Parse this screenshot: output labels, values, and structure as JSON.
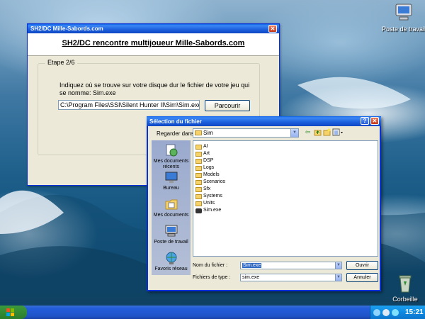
{
  "desktop": {
    "icons": [
      {
        "label": "Poste de travail"
      },
      {
        "label": "Corbeille"
      }
    ]
  },
  "wizard": {
    "window_title": "SH2/DC Mille-Sabords.com",
    "heading": "SH2/DC  rencontre multijoueur Mille-Sabords.com",
    "step_label": "Etape 2/6",
    "instruction": "Indiquez où se trouve sur votre disque dur le fichier de votre jeu qui se nomme: Sim.exe",
    "path_value": "C:\\Program Files\\SSI\\Silent Hunter II\\Sim\\Sim.exe",
    "browse_label": "Parcourir"
  },
  "dialog": {
    "title": "Sélection du fichier",
    "look_in_label": "Regarder dans :",
    "look_in_value": "Sim",
    "places": [
      {
        "label": "Mes documents récents"
      },
      {
        "label": "Bureau"
      },
      {
        "label": "Mes documents"
      },
      {
        "label": "Poste de travail"
      },
      {
        "label": "Favoris réseau"
      }
    ],
    "files": [
      {
        "name": "AI",
        "type": "folder"
      },
      {
        "name": "Art",
        "type": "folder"
      },
      {
        "name": "DSP",
        "type": "folder"
      },
      {
        "name": "Logs",
        "type": "folder"
      },
      {
        "name": "Models",
        "type": "folder"
      },
      {
        "name": "Scenarios",
        "type": "folder"
      },
      {
        "name": "Sfx",
        "type": "folder"
      },
      {
        "name": "Systems",
        "type": "folder"
      },
      {
        "name": "Units",
        "type": "folder"
      },
      {
        "name": "Sim.exe",
        "type": "exe"
      }
    ],
    "filename_label": "Nom du fichier :",
    "filename_value": "Sim.exe",
    "filetype_label": "Fichiers de type :",
    "filetype_value": "sim.exe",
    "open_label": "Ouvrir",
    "cancel_label": "Annuler"
  },
  "taskbar": {
    "clock": "15:21"
  }
}
